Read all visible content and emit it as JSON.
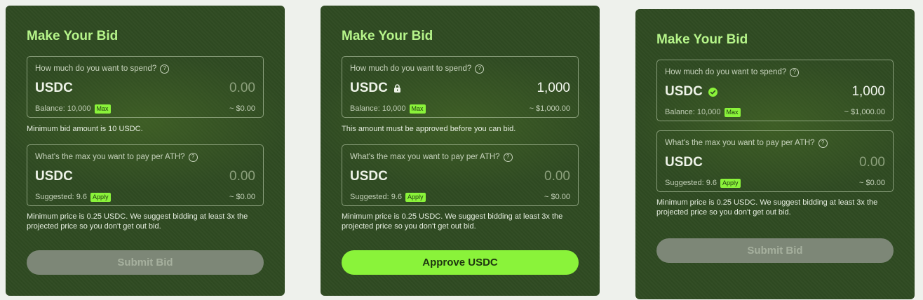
{
  "colors": {
    "accent": "#8af33a",
    "card_bg": "#2f4a22",
    "title": "#b6f58a",
    "page_bg": "#eef1ec"
  },
  "cards": [
    {
      "title": "Make Your Bid",
      "spend": {
        "label": "How much do you want to spend?",
        "currency": "USDC",
        "amount": "0.00",
        "balance": "Balance: 10,000",
        "chip": "Max",
        "usd": "~ $0.00"
      },
      "note1": "Minimum bid amount is 10 USDC.",
      "price": {
        "label": "What's the max you want to pay per ATH?",
        "currency": "USDC",
        "amount": "0.00",
        "suggested": "Suggested: 9.6",
        "chip": "Apply",
        "usd": "~ $0.00"
      },
      "note2": "Minimum price is 0.25 USDC. We suggest bidding at least 3x the projected price so you don't get out bid.",
      "button": "Submit Bid"
    },
    {
      "title": "Make Your Bid",
      "spend": {
        "label": "How much do you want to spend?",
        "currency": "USDC",
        "icon": "lock-icon",
        "amount": "1,000",
        "balance": "Balance: 10,000",
        "chip": "Max",
        "usd": "~ $1,000.00"
      },
      "note1": "This amount must be approved before you can bid.",
      "price": {
        "label": "What's the max you want to pay per ATH?",
        "currency": "USDC",
        "amount": "0.00",
        "suggested": "Suggested: 9.6",
        "chip": "Apply",
        "usd": "~ $0.00"
      },
      "note2": "Minimum price is 0.25 USDC. We suggest bidding at least 3x the projected price so you don't get out bid.",
      "button": "Approve USDC"
    },
    {
      "title": "Make Your Bid",
      "spend": {
        "label": "How much do you want to spend?",
        "currency": "USDC",
        "icon": "check-circle-icon",
        "amount": "1,000",
        "balance": "Balance: 10,000",
        "chip": "Max",
        "usd": "~ $1,000.00"
      },
      "price": {
        "label": "What's the max you want to pay per ATH?",
        "currency": "USDC",
        "amount": "0.00",
        "suggested": "Suggested: 9.6",
        "chip": "Apply",
        "usd": "~ $0.00"
      },
      "note2": "Minimum price is 0.25 USDC. We suggest bidding at least 3x the projected price so you don't get out bid.",
      "button": "Submit Bid"
    }
  ]
}
